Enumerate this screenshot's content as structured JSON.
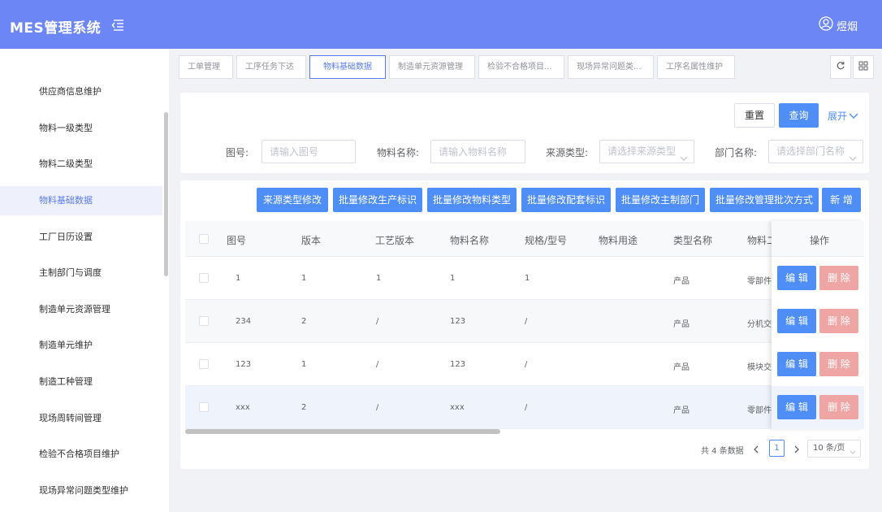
{
  "app": {
    "title": "MES管理系统",
    "user_name": "煜烟"
  },
  "sidebar": {
    "items": [
      {
        "label": "供应商信息维护"
      },
      {
        "label": "物料一级类型"
      },
      {
        "label": "物料二级类型"
      },
      {
        "label": "物料基础数据",
        "active": true
      },
      {
        "label": "工厂日历设置"
      },
      {
        "label": "主制部门与调度"
      },
      {
        "label": "制造单元资源管理"
      },
      {
        "label": "制造单元维护"
      },
      {
        "label": "制造工种管理"
      },
      {
        "label": "现场周转间管理"
      },
      {
        "label": "检验不合格项目维护"
      },
      {
        "label": "现场异常问题类型维护"
      }
    ]
  },
  "tabs": [
    {
      "label": "工单管理"
    },
    {
      "label": "工序任务下达"
    },
    {
      "label": "物料基础数据",
      "active": true
    },
    {
      "label": "制造单元资源管理"
    },
    {
      "label": "检验不合格项目..."
    },
    {
      "label": "现场异常问题类..."
    },
    {
      "label": "工序名属性维护"
    }
  ],
  "search": {
    "reset_label": "重置",
    "query_label": "查询",
    "expand_label": "展开",
    "fields": {
      "drawing_no": {
        "label": "图号:",
        "placeholder": "请输入图号"
      },
      "material_name": {
        "label": "物料名称:",
        "placeholder": "请输入物料名称"
      },
      "source_type": {
        "label": "来源类型:",
        "placeholder": "请选择来源类型"
      },
      "department": {
        "label": "部门名称:",
        "placeholder": "请选择部门名称"
      }
    }
  },
  "actions": {
    "source_type_edit": "来源类型修改",
    "batch_production_flag": "批量修改生产标识",
    "batch_material_type": "批量修改物料类型",
    "batch_kit_flag": "批量修改配套标识",
    "batch_main_dept": "批量修改主制部门",
    "batch_batch_mode": "批量修改管理批次方式",
    "add": "新 增"
  },
  "table": {
    "columns": [
      "图号",
      "版本",
      "工艺版本",
      "物料名称",
      "规格/型号",
      "物料用途",
      "类型名称",
      "物料二",
      "操作"
    ],
    "edit_label": "编 辑",
    "delete_label": "删 除",
    "rows": [
      {
        "drawing_no": "1",
        "version": "1",
        "process_version": "1",
        "material_name": "1",
        "spec": "1",
        "usage": "",
        "type_name": "产品",
        "material_2": "零部件"
      },
      {
        "drawing_no": "234",
        "version": "2",
        "process_version": "/",
        "material_name": "123",
        "spec": "/",
        "usage": "",
        "type_name": "产品",
        "material_2": "分机交"
      },
      {
        "drawing_no": "123",
        "version": "1",
        "process_version": "/",
        "material_name": "123",
        "spec": "/",
        "usage": "",
        "type_name": "产品",
        "material_2": "模块交"
      },
      {
        "drawing_no": "xxx",
        "version": "2",
        "process_version": "/",
        "material_name": "xxx",
        "spec": "/",
        "usage": "",
        "type_name": "产品",
        "material_2": "零部件"
      }
    ]
  },
  "pagination": {
    "total_text": "共 4 条数据",
    "current_page": "1",
    "page_size": "10 条/页"
  },
  "colors": {
    "header": "#6d86f5",
    "primary": "#4f8ef7",
    "danger_soft": "#f0a5a5",
    "active_text": "#5b7bf0"
  }
}
